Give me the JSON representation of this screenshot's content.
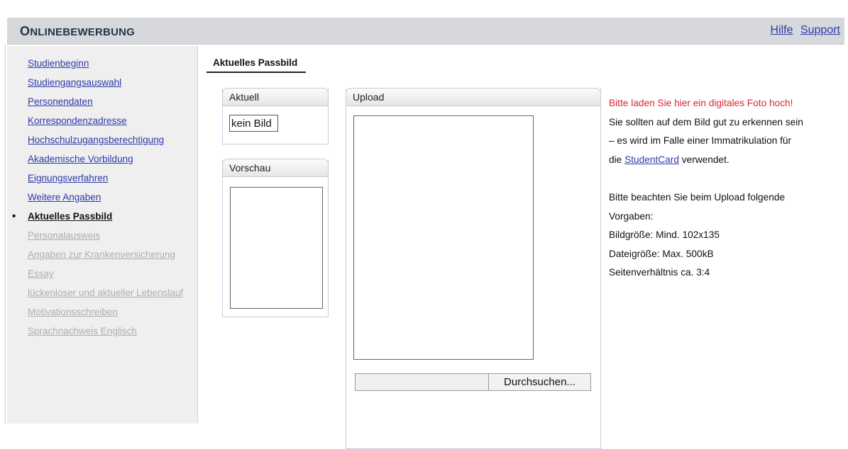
{
  "header": {
    "brand_first": "O",
    "brand_rest": "NLINEBEWERBUNG",
    "links": [
      "Hilfe",
      "Support"
    ]
  },
  "sidebar": {
    "items": [
      {
        "label": "Studienbeginn",
        "state": "link"
      },
      {
        "label": "Studiengangsauswahl",
        "state": "link"
      },
      {
        "label": "Personendaten",
        "state": "link"
      },
      {
        "label": "Korrespondenzadresse",
        "state": "link"
      },
      {
        "label": "Hochschulzugangsberechtigung",
        "state": "link"
      },
      {
        "label": "Akademische Vorbildung",
        "state": "link"
      },
      {
        "label": "Eignungsverfahren",
        "state": "link"
      },
      {
        "label": "Weitere Angaben",
        "state": "link"
      },
      {
        "label": "Aktuelles Passbild",
        "state": "active"
      },
      {
        "label": "Personalausweis",
        "state": "disabled"
      },
      {
        "label": "Angaben zur Krankenversicherung",
        "state": "disabled"
      },
      {
        "label": "Essay",
        "state": "disabled"
      },
      {
        "label": "lückenloser und aktueller Lebenslauf",
        "state": "disabled"
      },
      {
        "label": "Motivationsschreiben",
        "state": "disabled"
      },
      {
        "label": "Sprachnachweis Englisch",
        "state": "disabled"
      }
    ]
  },
  "main": {
    "tab": "Aktuelles Passbild",
    "aktuell": {
      "title": "Aktuell",
      "value": "kein Bild"
    },
    "vorschau": {
      "title": "Vorschau"
    },
    "upload": {
      "title": "Upload",
      "browse_label": "Durchsuchen..."
    },
    "info": {
      "warning": "Bitte laden Sie hier ein digitales Foto hoch!",
      "line1": "Sie sollten auf dem Bild gut zu erkennen sein",
      "line2": "– es wird im Falle einer Immatrikulation für",
      "line3_prefix": "die ",
      "line3_link": "StudentCard",
      "line3_suffix": " verwendet.",
      "req1": "Bitte beachten Sie beim Upload folgende",
      "req2": "Vorgaben:",
      "req3": "Bildgröße: Mind. 102x135",
      "req4": "Dateigröße: Max. 500kB",
      "req5": "Seitenverhältnis ca. 3:4"
    }
  },
  "colors": {
    "header_bg": "#d6d8dc",
    "sidebar_bg": "#efeff0",
    "link": "#2b3aa8",
    "warning": "#e1242d",
    "disabled": "#aeaeae"
  }
}
